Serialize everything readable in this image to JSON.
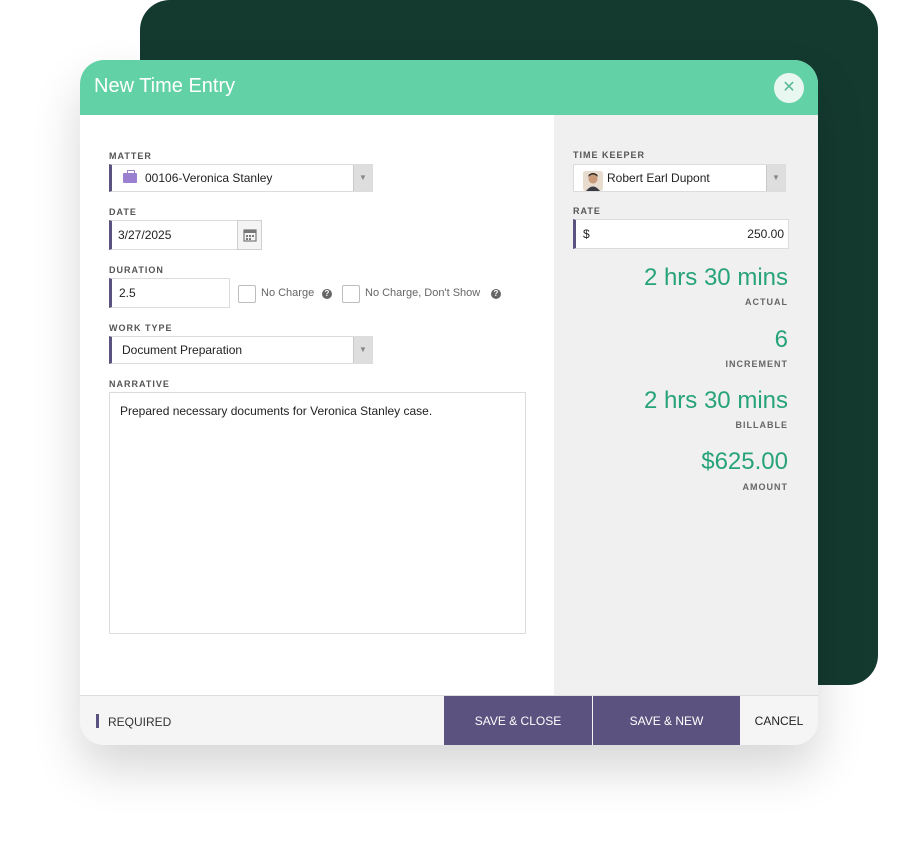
{
  "modal": {
    "title": "New Time Entry",
    "close_symbol": "✕"
  },
  "form": {
    "matter": {
      "label": "MATTER",
      "value": "00106-Veronica Stanley",
      "icon": "briefcase-icon"
    },
    "date": {
      "label": "DATE",
      "value": "3/27/2025"
    },
    "duration": {
      "label": "DURATION",
      "value": "2.5"
    },
    "no_charge": {
      "label": "No Charge",
      "checked": false
    },
    "no_charge_dont_show": {
      "label": "No Charge, Don't Show",
      "checked": false
    },
    "work_type": {
      "label": "WORK TYPE",
      "value": "Document Preparation"
    },
    "narrative": {
      "label": "NARRATIVE",
      "value": "Prepared necessary documents for Veronica Stanley case."
    }
  },
  "side": {
    "time_keeper": {
      "label": "TIME KEEPER",
      "value": "Robert Earl Dupont"
    },
    "rate": {
      "label": "RATE",
      "currency": "$",
      "value": "250.00"
    },
    "stats": [
      {
        "value": "2 hrs 30 mins",
        "label": "ACTUAL"
      },
      {
        "value": "6",
        "label": "INCREMENT"
      },
      {
        "value": "2 hrs 30 mins",
        "label": "BILLABLE"
      },
      {
        "value": "$625.00",
        "label": "AMOUNT"
      }
    ]
  },
  "footer": {
    "required_label": "REQUIRED",
    "save_close": "SAVE & CLOSE",
    "save_new": "SAVE & NEW",
    "cancel": "CANCEL"
  },
  "colors": {
    "header": "#63d1a6",
    "background_card": "#143a2f",
    "accent_bar": "#5c527f",
    "stat_text": "#27a37a",
    "primary_button": "#5c527f"
  }
}
